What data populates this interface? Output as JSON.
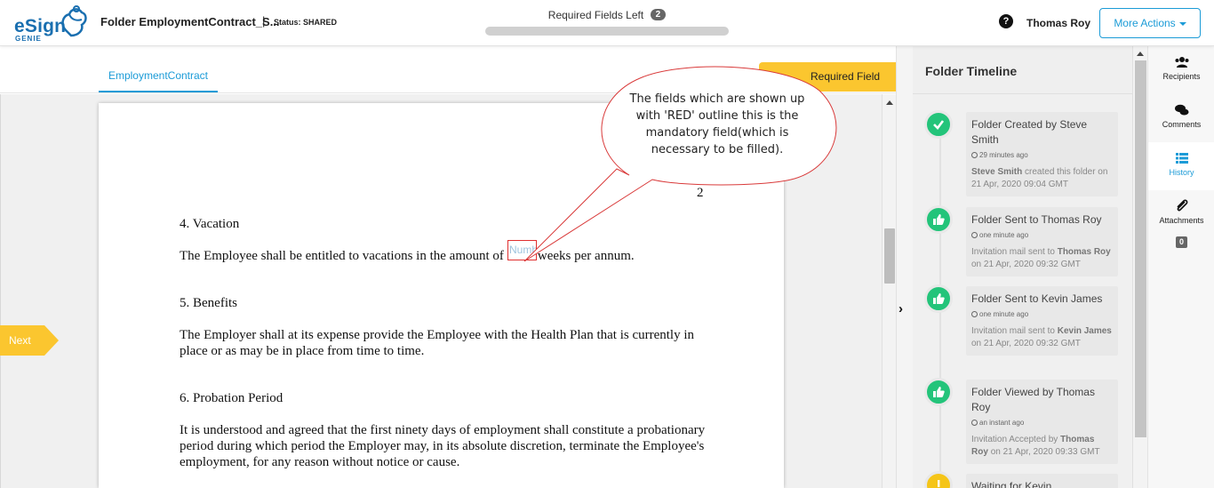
{
  "header": {
    "logo_main": "eSign",
    "logo_sub": "GENIE",
    "folder_title": "Folder EmploymentContract_S...",
    "separator": "|",
    "status": "Status: SHARED",
    "required_fields_label": "Required Fields Left",
    "required_fields_count": "2",
    "help_icon": "question-circle-icon",
    "user_name": "Thomas Roy",
    "more_actions_label": "More Actions"
  },
  "tabs": {
    "document_tab": "EmploymentContract",
    "required_field_button": "Required Field"
  },
  "document": {
    "page_number": "2",
    "sections": [
      {
        "heading": "4. Vacation"
      },
      {
        "heading": "5. Benefits",
        "text": "The Employer shall at its expense provide the Employee with the Health Plan that is currently in place or as may be in place from time to time."
      },
      {
        "heading": "6. Probation Period",
        "text": "It is understood and agreed that the first ninety days of employment shall constitute a probationary period during which period the Employer may, in its absolute discretion, terminate the Employee's employment, for any reason without notice or cause."
      }
    ],
    "vacation_text_before": "The Employee shall be entitled to vacations in the amount of",
    "vacation_field_placeholder": "Numb",
    "vacation_text_after": "weeks per annum."
  },
  "navigation": {
    "next_label": "Next",
    "collapse_icon": "chevron-right-icon"
  },
  "callout": {
    "text": "The fields which are shown up with 'RED' outline this is the mandatory field(which is necessary to be filled)."
  },
  "timeline": {
    "title": "Folder Timeline",
    "events": [
      {
        "icon": "check-icon",
        "title": "Folder Created by Steve Smith",
        "time": "29 minutes ago",
        "actor": "Steve Smith",
        "desc": "created this folder on 21 Apr, 2020 09:04 GMT"
      },
      {
        "icon": "thumbs-up-icon",
        "title": "Folder Sent to Thomas Roy",
        "time": "one minute ago",
        "desc_prefix": "Invitation mail sent to",
        "actor": "Thomas Roy",
        "desc": "on 21 Apr, 2020 09:32 GMT"
      },
      {
        "icon": "thumbs-up-icon",
        "title": "Folder Sent to Kevin James",
        "time": "one minute ago",
        "desc_prefix": "Invitation mail sent to",
        "actor": "Kevin James",
        "desc": "on 21 Apr, 2020 09:32 GMT"
      },
      {
        "icon": "thumbs-up-icon",
        "title": "Folder Viewed by Thomas Roy",
        "time": "an instant ago",
        "desc_prefix": "Invitation Accepted by",
        "actor": "Thomas Roy",
        "desc": "on 21 Apr, 2020 09:33 GMT"
      },
      {
        "icon": "exclamation-icon",
        "title": "Waiting for Kevin"
      }
    ]
  },
  "tools": [
    {
      "icon": "users-icon",
      "label": "Recipients"
    },
    {
      "icon": "comments-icon",
      "label": "Comments"
    },
    {
      "icon": "list-icon",
      "label": "History",
      "active": true
    },
    {
      "icon": "paperclip-icon",
      "label": "Attachments",
      "badge": "0"
    }
  ],
  "colors": {
    "accent": "#1b9bd7",
    "brand": "#1a6fb0",
    "highlight": "#fbc62f",
    "success": "#23c47a",
    "required_outline": "#e03030"
  }
}
